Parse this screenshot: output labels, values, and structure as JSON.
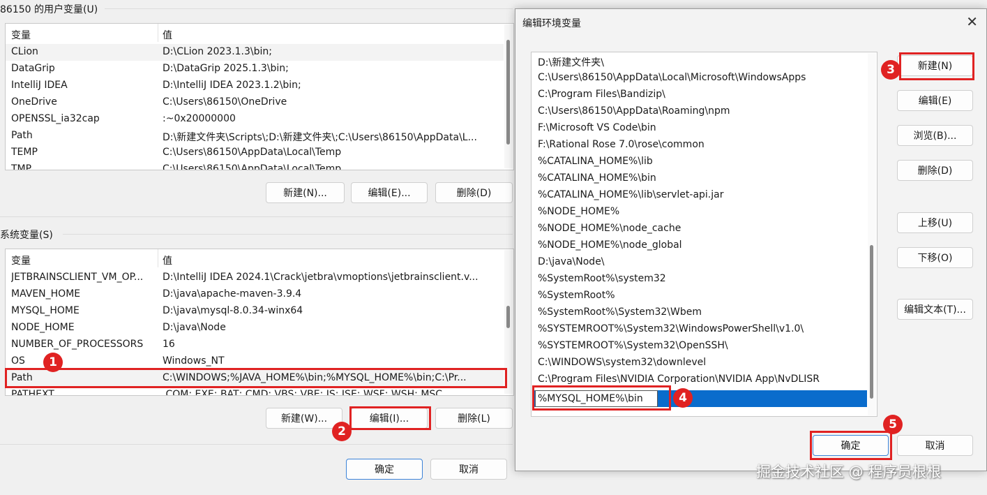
{
  "user_vars": {
    "label": "86150 的用户变量(U)",
    "header": {
      "name": "变量",
      "value": "值"
    },
    "rows": [
      {
        "name": "CLion",
        "value": "D:\\CLion 2023.1.3\\bin;"
      },
      {
        "name": "DataGrip",
        "value": "D:\\DataGrip 2025.1.3\\bin;"
      },
      {
        "name": "IntelliJ IDEA",
        "value": "D:\\IntelliJ IDEA 2023.1.2\\bin;"
      },
      {
        "name": "OneDrive",
        "value": "C:\\Users\\86150\\OneDrive"
      },
      {
        "name": "OPENSSL_ia32cap",
        "value": ":~0x20000000"
      },
      {
        "name": "Path",
        "value": "D:\\新建文件夹\\Scripts\\;D:\\新建文件夹\\;C:\\Users\\86150\\AppData\\L..."
      },
      {
        "name": "TEMP",
        "value": "C:\\Users\\86150\\AppData\\Local\\Temp"
      },
      {
        "name": "TMP",
        "value": "C:\\Users\\86150\\AppData\\Local\\Temp"
      }
    ],
    "buttons": {
      "new": "新建(N)...",
      "edit": "编辑(E)...",
      "delete": "删除(D)"
    }
  },
  "sys_vars": {
    "label": "系统变量(S)",
    "header": {
      "name": "变量",
      "value": "值"
    },
    "rows": [
      {
        "name": "JETBRAINSCLIENT_VM_OP...",
        "value": "D:\\IntelliJ IDEA 2024.1\\Crack\\jetbra\\vmoptions\\jetbrainsclient.v..."
      },
      {
        "name": "MAVEN_HOME",
        "value": "D:\\java\\apache-maven-3.9.4"
      },
      {
        "name": "MYSQL_HOME",
        "value": "D:\\java\\mysql-8.0.34-winx64"
      },
      {
        "name": "NODE_HOME",
        "value": "D:\\java\\Node"
      },
      {
        "name": "NUMBER_OF_PROCESSORS",
        "value": "16"
      },
      {
        "name": "OS",
        "value": "Windows_NT"
      },
      {
        "name": "Path",
        "value": "C:\\WINDOWS;%JAVA_HOME%\\bin;%MYSQL_HOME%\\bin;C:\\Pr..."
      },
      {
        "name": "PATHEXT",
        "value": ".COM;.EXE;.BAT;.CMD;.VBS;.VBE;.JS;.JSE;.WSF;.WSH;.MSC"
      }
    ],
    "buttons": {
      "new": "新建(W)...",
      "edit": "编辑(I)...",
      "delete": "删除(L)"
    }
  },
  "main_buttons": {
    "ok": "确定",
    "cancel": "取消"
  },
  "dialog": {
    "title": "编辑环境变量",
    "close_glyph": "✕",
    "paths": [
      "D:\\新建文件夹\\",
      "C:\\Users\\86150\\AppData\\Local\\Microsoft\\WindowsApps",
      "C:\\Program Files\\Bandizip\\",
      "C:\\Users\\86150\\AppData\\Roaming\\npm",
      "F:\\Microsoft VS Code\\bin",
      "F:\\Rational Rose 7.0\\rose\\common",
      "%CATALINA_HOME%\\lib",
      "%CATALINA_HOME%\\bin",
      "%CATALINA_HOME%\\lib\\servlet-api.jar",
      "%NODE_HOME%",
      "%NODE_HOME%\\node_cache",
      "%NODE_HOME%\\node_global",
      "D:\\java\\Node\\",
      "%SystemRoot%\\system32",
      "%SystemRoot%",
      "%SystemRoot%\\System32\\Wbem",
      "%SYSTEMROOT%\\System32\\WindowsPowerShell\\v1.0\\",
      "%SYSTEMROOT%\\System32\\OpenSSH\\",
      "C:\\WINDOWS\\system32\\downlevel",
      "C:\\Program Files\\NVIDIA Corporation\\NVIDIA App\\NvDLISR"
    ],
    "editing_value": "%MYSQL_HOME%\\bin",
    "buttons": {
      "new": "新建(N)",
      "edit": "编辑(E)",
      "browse": "浏览(B)...",
      "delete": "删除(D)",
      "move_up": "上移(U)",
      "move_down": "下移(O)",
      "edit_text": "编辑文本(T)...",
      "ok": "确定",
      "cancel": "取消"
    }
  },
  "annotations": [
    "1",
    "2",
    "3",
    "4",
    "5"
  ],
  "watermark": "掘金技术社区 @ 程序员根根",
  "colors": {
    "highlight": "#e02222",
    "selection": "#0a6ccc"
  }
}
